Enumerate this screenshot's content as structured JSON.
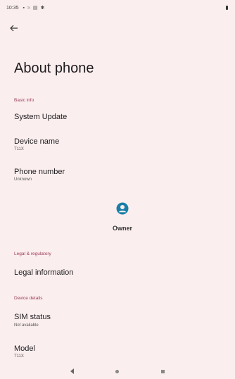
{
  "status_bar": {
    "time": "10:35",
    "icons": [
      "notification-icon",
      "wifi-icon",
      "sim-icon",
      "settings-icon"
    ]
  },
  "header": {
    "title": "About phone"
  },
  "sections": {
    "basic_info": {
      "header": "Basic info",
      "system_update": {
        "title": "System Update"
      },
      "device_name": {
        "title": "Device name",
        "value": "T11X"
      },
      "phone_number": {
        "title": "Phone number",
        "value": "Unknown"
      }
    },
    "owner": {
      "label": "Owner"
    },
    "legal": {
      "header": "Legal & regulatory",
      "legal_information": {
        "title": "Legal information"
      }
    },
    "device_details": {
      "header": "Device details",
      "sim_status": {
        "title": "SIM status",
        "value": "Not available"
      },
      "model": {
        "title": "Model",
        "value": "T11X"
      }
    }
  },
  "colors": {
    "background": "#fbeeee",
    "section_header": "#9a3b5c",
    "avatar": "#1a7ea6"
  }
}
